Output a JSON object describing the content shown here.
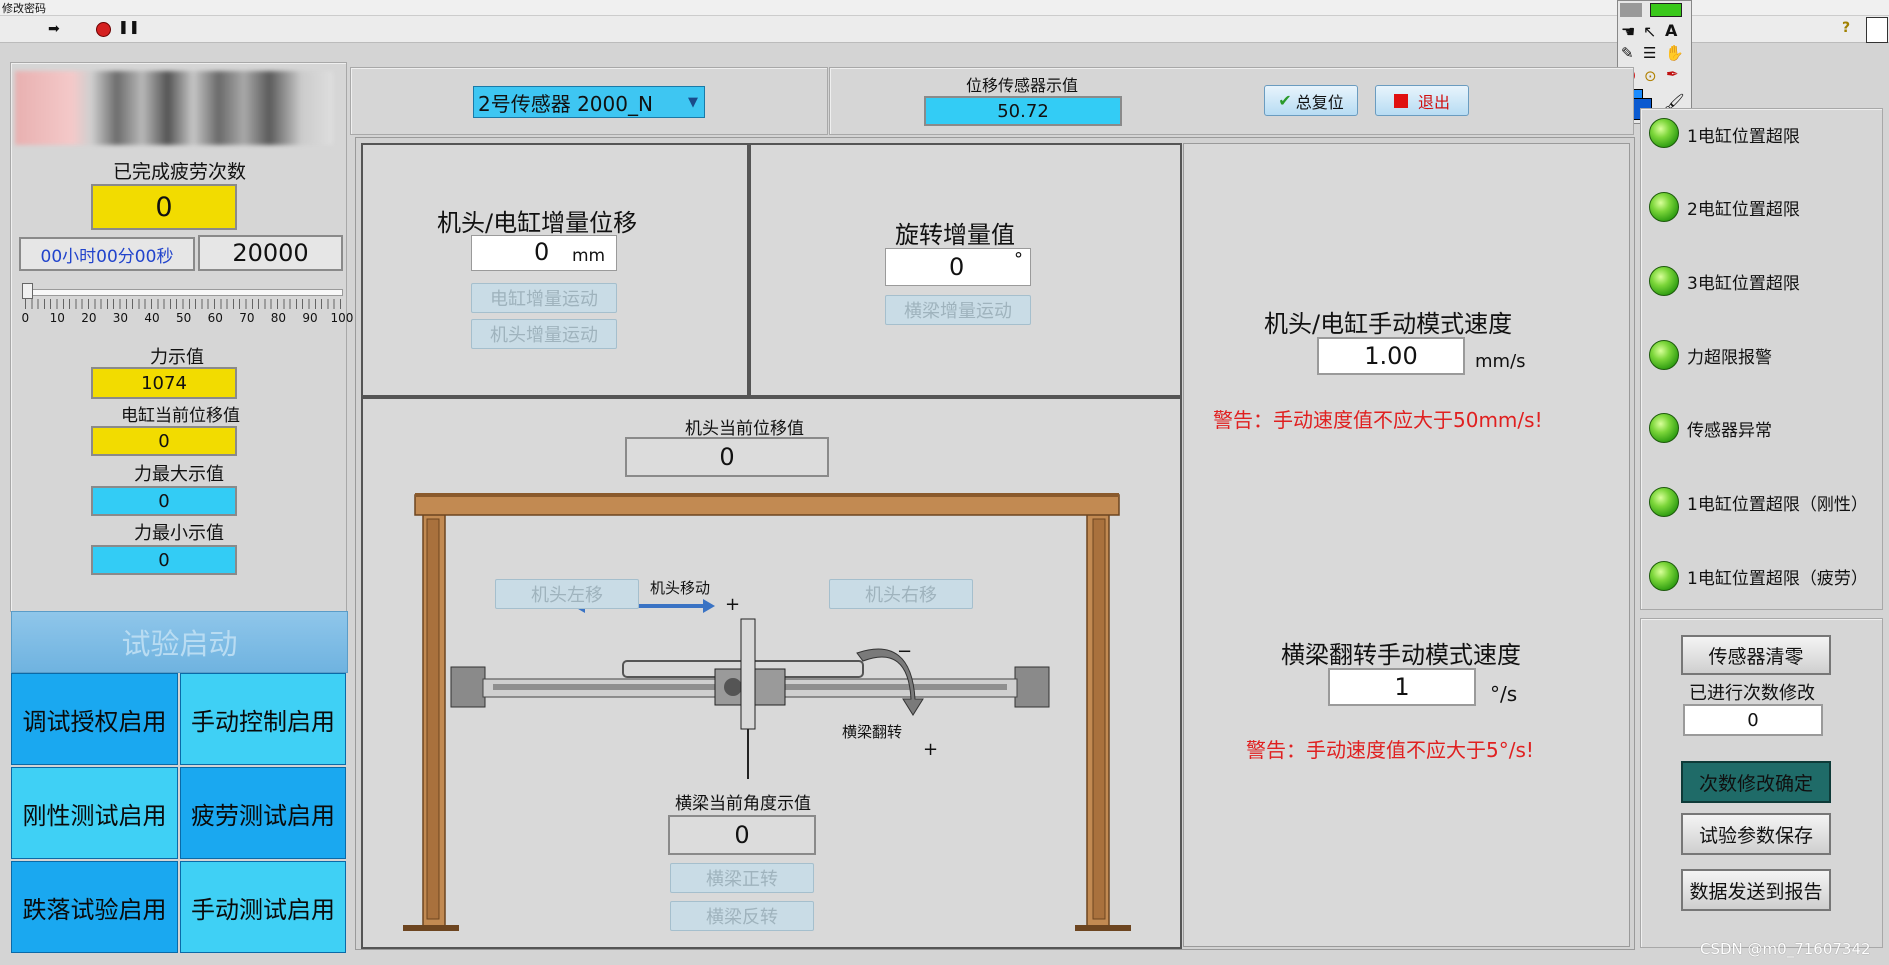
{
  "window": {
    "title": "修改密码"
  },
  "left": {
    "completed_label": "已完成疲劳次数",
    "completed_value": "0",
    "time_value": "00小时00分00秒",
    "target_value": "20000",
    "slider_ticks": [
      "0",
      "10",
      "20",
      "30",
      "40",
      "50",
      "60",
      "70",
      "80",
      "90",
      "100"
    ],
    "slider_progress_percent": 0,
    "force_label": "力示值",
    "force_value": "1074",
    "disp_label": "电缸当前位移值",
    "disp_value": "0",
    "force_max_label": "力最大示值",
    "force_max_value": "0",
    "force_min_label": "力最小示值",
    "force_min_value": "0",
    "start_label": "试验启动",
    "tiles": [
      "调试授权启用",
      "手动控制启用",
      "刚性测试启用",
      "疲劳测试启用",
      "跌落试验启用",
      "手动测试启用"
    ]
  },
  "top": {
    "sensor_select": "2号传感器 2000_N",
    "disp_sensor_label": "位移传感器示值",
    "disp_sensor_value": "50.72",
    "reset_label": "总复位",
    "exit_label": "退出"
  },
  "incr": {
    "title": "机头/电缸增量位移",
    "value": "0",
    "unit": "mm",
    "btn_cyl": "电缸增量运动",
    "btn_head": "机头增量运动"
  },
  "rot": {
    "title": "旋转增量值",
    "value": "0",
    "unit": "°",
    "btn": "横梁增量运动"
  },
  "machine": {
    "head_disp_label": "机头当前位移值",
    "head_disp_value": "0",
    "left_btn": "机头左移",
    "right_btn": "机头右移",
    "move_label": "机头移动",
    "minus": "−",
    "plus": "+",
    "flip_label": "横梁翻转",
    "angle_label": "横梁当前角度示值",
    "angle_value": "0",
    "fwd_btn": "横梁正转",
    "rev_btn": "横梁反转"
  },
  "speed": {
    "head_title": "机头/电缸手动模式速度",
    "head_value": "1.00",
    "head_unit": "mm/s",
    "head_warn": "警告：手动速度值不应大于50mm/s!",
    "beam_title": "横梁翻转手动模式速度",
    "beam_value": "1",
    "beam_unit": "°/s",
    "beam_warn": "警告：手动速度值不应大于5°/s!"
  },
  "alarms": [
    "1电缸位置超限",
    "2电缸位置超限",
    "3电缸位置超限",
    "力超限报警",
    "传感器异常",
    "1电缸位置超限（刚性）",
    "1电缸位置超限（疲劳）"
  ],
  "right": {
    "zero_btn": "传感器清零",
    "count_label": "已进行次数修改",
    "count_value": "0",
    "confirm_btn": "次数修改确定",
    "save_btn": "试验参数保存",
    "report_btn": "数据发送到报告"
  },
  "watermark": "CSDN @m0_71607342",
  "colors": {
    "yellow": "#f2dc00",
    "cyan": "#33ccf5",
    "tile_blue": "#1aa8f0",
    "tile_cyan": "#3fd0f5",
    "warning": "#e02020",
    "led_green": "#3cb81a",
    "confirm_teal": "#1f6b68"
  }
}
